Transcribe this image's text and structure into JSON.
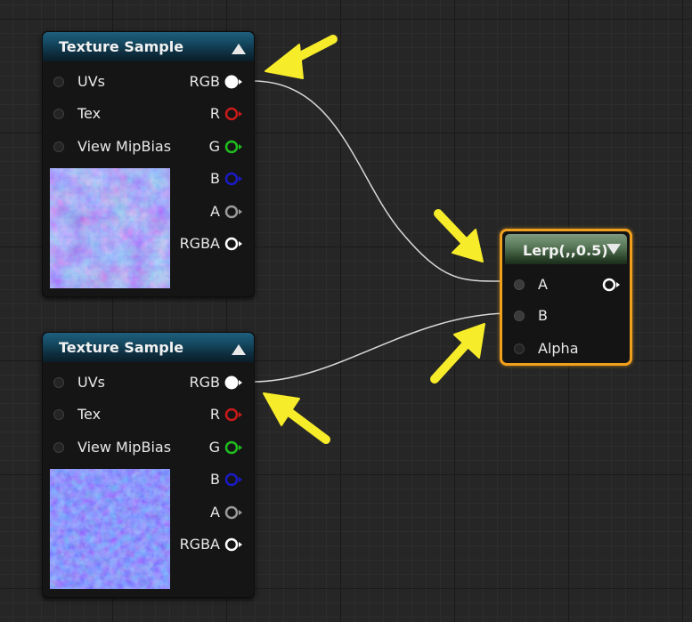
{
  "nodes": [
    {
      "title": "Texture Sample",
      "inputs": [
        "UVs",
        "Tex",
        "View MipBias"
      ],
      "outputs": [
        {
          "label": "RGB",
          "color": "#ffffff"
        },
        {
          "label": "R",
          "color": "#cc1a1a"
        },
        {
          "label": "G",
          "color": "#1fbf1f"
        },
        {
          "label": "B",
          "color": "#1a1ac8"
        },
        {
          "label": "A",
          "color": "#9a9a9a"
        },
        {
          "label": "RGBA",
          "color": "#ffffff"
        }
      ],
      "preview": "normal-map-rock-thumbnail"
    },
    {
      "title": "Texture Sample",
      "inputs": [
        "UVs",
        "Tex",
        "View MipBias"
      ],
      "outputs": [
        {
          "label": "RGB",
          "color": "#ffffff"
        },
        {
          "label": "R",
          "color": "#cc1a1a"
        },
        {
          "label": "G",
          "color": "#1fbf1f"
        },
        {
          "label": "B",
          "color": "#1a1ac8"
        },
        {
          "label": "A",
          "color": "#9a9a9a"
        },
        {
          "label": "RGBA",
          "color": "#ffffff"
        }
      ],
      "preview": "normal-map-fine-thumbnail"
    }
  ],
  "lerp": {
    "title": "Lerp(,,0.5)",
    "inputs": [
      "A",
      "B",
      "Alpha"
    ],
    "border_color": "#f0a01c"
  },
  "annotations": {
    "arrow_color": "#f7ec2a",
    "arrow_count": 4
  }
}
